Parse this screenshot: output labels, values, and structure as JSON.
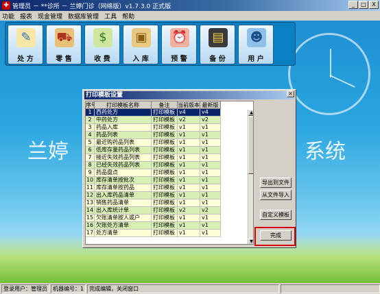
{
  "window": {
    "title": "管理员 － **诊所 － 兰婷门诊（网络版）v1.7.3.0 正式版",
    "min_label": "_",
    "max_label": "□",
    "close_label": "X"
  },
  "menu": [
    "功能",
    "报表",
    "现金管理",
    "数据库管理",
    "工具",
    "帮助"
  ],
  "toolbar": [
    {
      "label": "处 方",
      "icon": "prescription-icon"
    },
    {
      "label": "零 售",
      "icon": "retail-cart-icon"
    },
    {
      "label": "收 费",
      "icon": "charge-money-icon"
    },
    {
      "label": "入 库",
      "icon": "delivery-truck-icon"
    },
    {
      "label": "预 警",
      "icon": "alarm-clock-icon"
    },
    {
      "label": "备 份",
      "icon": "floppy-disk-icon"
    },
    {
      "label": "用 户",
      "icon": "user-icon"
    }
  ],
  "background_text": {
    "left": "兰婷",
    "right": "系统"
  },
  "dialog": {
    "title": "打印模板设置",
    "close_label": "×",
    "columns": [
      "序号",
      "打印模板名称",
      "备注",
      "当前版本",
      "最新版"
    ],
    "rows": [
      [
        "1",
        "西药处方",
        "打印模板",
        "v4",
        "v4"
      ],
      [
        "2",
        "中药处方",
        "打印模板",
        "v2",
        "v2"
      ],
      [
        "3",
        "药品入库",
        "打印模板",
        "v1",
        "v1"
      ],
      [
        "4",
        "药品列表",
        "打印模板",
        "v1",
        "v1"
      ],
      [
        "5",
        "最近购药品列表",
        "打印模板",
        "v1",
        "v1"
      ],
      [
        "6",
        "低库存量药品列表",
        "打印模板",
        "v1",
        "v1"
      ],
      [
        "7",
        "接近失效药品列表",
        "打印模板",
        "v1",
        "v1"
      ],
      [
        "8",
        "已经失效药品列表",
        "打印模板",
        "v1",
        "v1"
      ],
      [
        "9",
        "药品盘点",
        "打印模板",
        "v1",
        "v1"
      ],
      [
        "10",
        "库存清单按批次",
        "打印模板",
        "v1",
        "v1"
      ],
      [
        "11",
        "库存清单按药品",
        "打印模板",
        "v1",
        "v1"
      ],
      [
        "12",
        "出入库药品清单",
        "打印模板",
        "v1",
        "v1"
      ],
      [
        "13",
        "销售药品清单",
        "打印模板",
        "v1",
        "v1"
      ],
      [
        "14",
        "出入库统计单",
        "打印模板",
        "v2",
        "v2"
      ],
      [
        "15",
        "欠账清单按人或户",
        "打印模板",
        "v1",
        "v1"
      ],
      [
        "16",
        "欠账处方清单",
        "打印模板",
        "v1",
        "v1"
      ],
      [
        "17",
        "处方清单",
        "打印模板",
        "v1",
        "v1"
      ]
    ],
    "buttons": {
      "export": "导出到文件",
      "import": "从文件导入",
      "custom": "自定义模板",
      "done": "完成"
    }
  },
  "status": {
    "user": "登录用户：管理员",
    "machine": "机器编号：1",
    "message": "完成编辑，关闭窗口"
  },
  "colors": {
    "selected_row": "#0a246a",
    "odd_row": "#ffffd8",
    "even_row": "#d9f0b4",
    "highlight_box": "#d60000"
  }
}
